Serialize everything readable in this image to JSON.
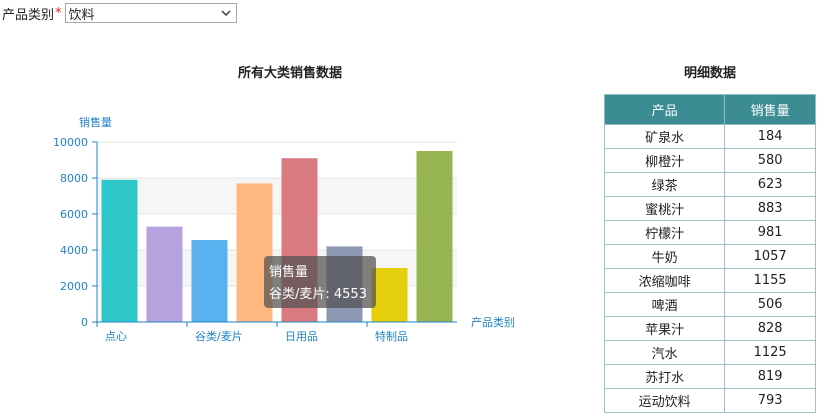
{
  "filter": {
    "label": "产品类别",
    "required_mark": "*",
    "selected": "饮料"
  },
  "chart_title": "所有大类销售数据",
  "chart_data": {
    "type": "bar",
    "ylabel": "销售量",
    "xlabel": "产品类别",
    "ylim": [
      0,
      10000
    ],
    "y_ticks": [
      0,
      2000,
      4000,
      6000,
      8000,
      10000
    ],
    "grid": true,
    "categories": [
      "点心",
      "",
      "谷类/麦片",
      "",
      "日用品",
      "",
      "特制品",
      ""
    ],
    "values": [
      7900,
      5300,
      4553,
      7700,
      9100,
      4200,
      3000,
      9500
    ],
    "colors": [
      "#2ec7c9",
      "#b6a2de",
      "#5ab1ef",
      "#ffb980",
      "#d87a80",
      "#8d98b3",
      "#e5cf0d",
      "#97b552"
    ]
  },
  "tooltip": {
    "series": "销售量",
    "text": "谷类/麦片: 4553"
  },
  "table_title": "明细数据",
  "table": {
    "headers": [
      "产品",
      "销售量"
    ],
    "rows": [
      [
        "矿泉水",
        "184"
      ],
      [
        "柳橙汁",
        "580"
      ],
      [
        "绿茶",
        "623"
      ],
      [
        "蜜桃汁",
        "883"
      ],
      [
        "柠檬汁",
        "981"
      ],
      [
        "牛奶",
        "1057"
      ],
      [
        "浓缩咖啡",
        "1155"
      ],
      [
        "啤酒",
        "506"
      ],
      [
        "苹果汁",
        "828"
      ],
      [
        "汽水",
        "1125"
      ],
      [
        "苏打水",
        "819"
      ],
      [
        "运动饮料",
        "793"
      ]
    ]
  }
}
